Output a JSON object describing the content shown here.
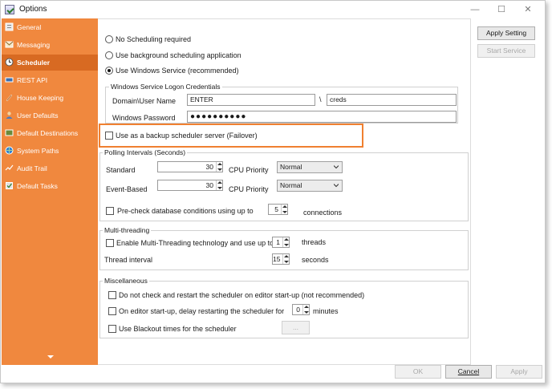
{
  "window": {
    "title": "Options",
    "minimize": "—",
    "maximize": "☐",
    "close": "✕"
  },
  "sidebar": {
    "items": [
      {
        "label": "General",
        "icon": "general-icon"
      },
      {
        "label": "Messaging",
        "icon": "messaging-icon"
      },
      {
        "label": "Scheduler",
        "icon": "scheduler-icon"
      },
      {
        "label": "REST API",
        "icon": "rest-api-icon"
      },
      {
        "label": "House Keeping",
        "icon": "house-keeping-icon"
      },
      {
        "label": "User Defaults",
        "icon": "user-defaults-icon"
      },
      {
        "label": "Default Destinations",
        "icon": "default-destinations-icon"
      },
      {
        "label": "System Paths",
        "icon": "system-paths-icon"
      },
      {
        "label": "Audit Trail",
        "icon": "audit-trail-icon"
      },
      {
        "label": "Default Tasks",
        "icon": "default-tasks-icon"
      }
    ],
    "active": "Scheduler"
  },
  "scheduling": {
    "options": [
      "No Scheduling required",
      "Use background scheduling application",
      "Use Windows Service (recommended)"
    ],
    "selected": "Use Windows Service (recommended)"
  },
  "credentials": {
    "legend": "Windows Service Logon Credentials",
    "domain_label": "Domain\\User Name",
    "domain_value": "ENTER",
    "separator": "\\",
    "user_value": "creds",
    "password_label": "Windows Password",
    "password_value": "●●●●●●●●●●"
  },
  "failover": {
    "label": "Use as a backup scheduler server (Failover)",
    "checked": false
  },
  "polling": {
    "legend": "Polling Intervals (Seconds)",
    "standard_label": "Standard",
    "standard_value": "30",
    "event_label": "Event-Based",
    "event_value": "30",
    "cpu_priority_label": "CPU Priority",
    "standard_priority": "Normal",
    "event_priority": "Normal",
    "precheck_label": "Pre-check database conditions using up to",
    "precheck_value": "5",
    "precheck_unit": "connections"
  },
  "multithreading": {
    "legend": "Multi-threading",
    "enable_label": "Enable Multi-Threading technology and use up to",
    "threads_value": "1",
    "threads_unit": "threads",
    "interval_label": "Thread interval",
    "interval_value": "15",
    "interval_unit": "seconds"
  },
  "misc": {
    "legend": "Miscellaneous",
    "no_restart_label": "Do not check and restart the scheduler on editor start-up (not recommended)",
    "delay_label": "On editor start-up, delay restarting the scheduler for",
    "delay_value": "0",
    "delay_unit": "minutes",
    "blackout_label": "Use Blackout times for the scheduler",
    "blackout_button": "..."
  },
  "side_buttons": {
    "apply_setting": "Apply Setting",
    "start_service": "Start Service"
  },
  "footer": {
    "ok": "OK",
    "cancel": "Cancel",
    "apply": "Apply"
  },
  "colors": {
    "sidebar": "#f0883e",
    "sidebar_active": "#d86a22",
    "highlight": "#f08030"
  }
}
